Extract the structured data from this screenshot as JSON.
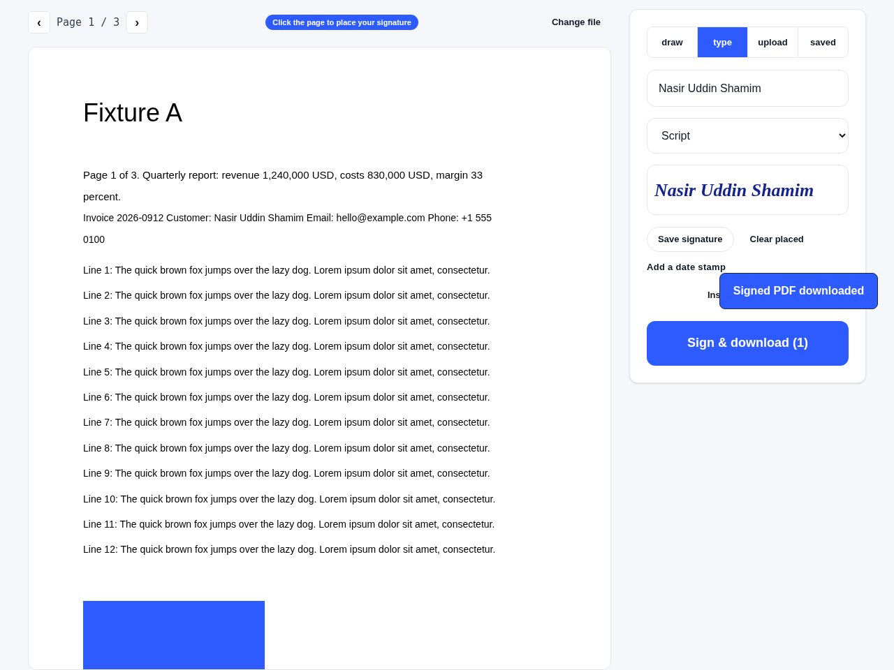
{
  "pager": {
    "prev": "‹",
    "label": "Page",
    "current": "1",
    "separator": "/",
    "total": "3",
    "next": "›"
  },
  "hint": "Click the page to place your signature",
  "change_file": "Change file",
  "document": {
    "title": "Fixture A",
    "summary": "Page 1 of 3. Quarterly report: revenue 1,240,000 USD, costs 830,000 USD, margin 33 percent.",
    "invoice": "Invoice 2026-0912  Customer: Nasir Uddin Shamim  Email: hello@example.com  Phone: +1 555 0100",
    "lines": [
      "Line 1: The quick brown fox jumps over the lazy dog. Lorem ipsum dolor sit amet, consectetur.",
      "Line 2: The quick brown fox jumps over the lazy dog. Lorem ipsum dolor sit amet, consectetur.",
      "Line 3: The quick brown fox jumps over the lazy dog. Lorem ipsum dolor sit amet, consectetur.",
      "Line 4: The quick brown fox jumps over the lazy dog. Lorem ipsum dolor sit amet, consectetur.",
      "Line 5: The quick brown fox jumps over the lazy dog. Lorem ipsum dolor sit amet, consectetur.",
      "Line 6: The quick brown fox jumps over the lazy dog. Lorem ipsum dolor sit amet, consectetur.",
      "Line 7: The quick brown fox jumps over the lazy dog. Lorem ipsum dolor sit amet, consectetur.",
      "Line 8: The quick brown fox jumps over the lazy dog. Lorem ipsum dolor sit amet, consectetur.",
      "Line 9: The quick brown fox jumps over the lazy dog. Lorem ipsum dolor sit amet, consectetur.",
      "Line 10: The quick brown fox jumps over the lazy dog. Lorem ipsum dolor sit amet, consectetur.",
      "Line 11: The quick brown fox jumps over the lazy dog. Lorem ipsum dolor sit amet, consectetur.",
      "Line 12: The quick brown fox jumps over the lazy dog. Lorem ipsum dolor sit amet, consectetur."
    ]
  },
  "tabs": [
    {
      "label": "draw",
      "selected": false
    },
    {
      "label": "type",
      "selected": true
    },
    {
      "label": "upload",
      "selected": false
    },
    {
      "label": "saved",
      "selected": false
    }
  ],
  "name_field": {
    "value": "Nasir Uddin Shamim"
  },
  "font_select": {
    "value": "Script"
  },
  "preview": "Nasir Uddin Shamim",
  "save_signature": "Save signature",
  "clear_placed": "Clear placed",
  "date_stamp": "Add a date stamp",
  "partial_text": "Ins",
  "toast": "Signed PDF downloaded",
  "sign_button": "Sign & download (1)"
}
